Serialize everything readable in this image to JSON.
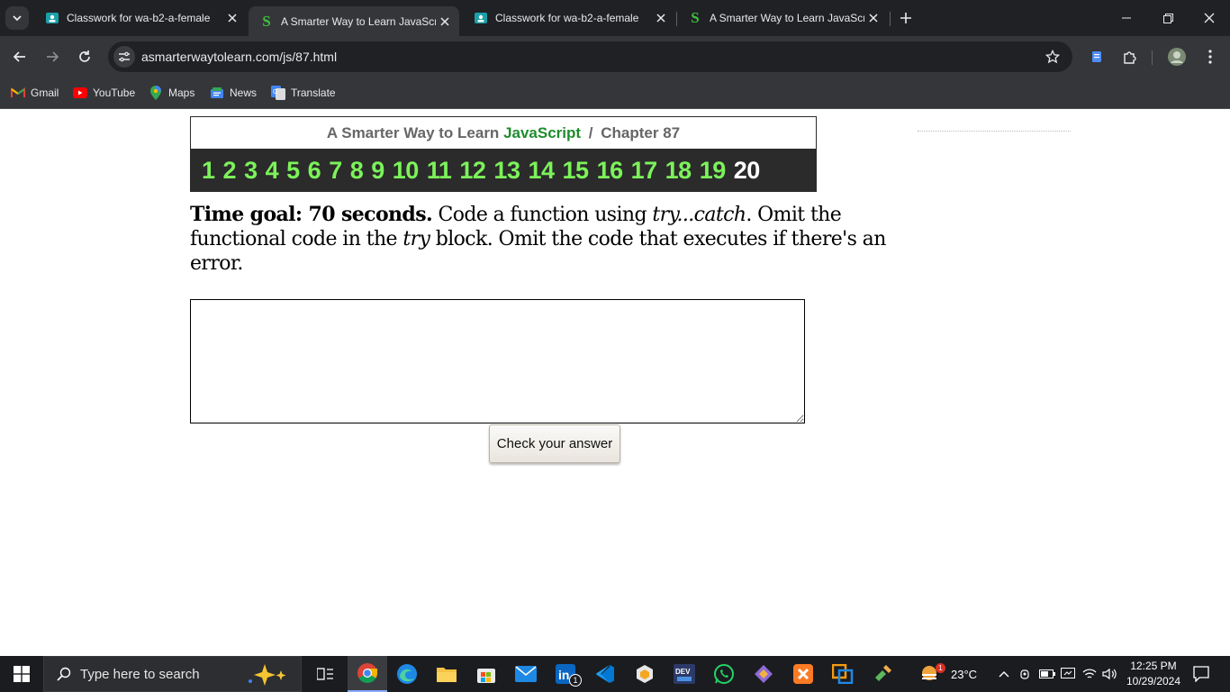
{
  "browser": {
    "tabs": [
      {
        "title": "Classwork for wa-b2-a-female",
        "active": false
      },
      {
        "title": "A Smarter Way to Learn JavaScr",
        "active": true
      },
      {
        "title": "Classwork for wa-b2-a-female",
        "active": false
      },
      {
        "title": "A Smarter Way to Learn JavaScr",
        "active": false
      }
    ],
    "url": "asmarterwaytolearn.com/js/87.html",
    "bookmarks": [
      "Gmail",
      "YouTube",
      "Maps",
      "News",
      "Translate"
    ]
  },
  "page": {
    "header_prefix": "A Smarter Way to Learn",
    "header_js": "JavaScript",
    "header_sep": "/",
    "header_chapter": "Chapter 87",
    "chapters": [
      "1",
      "2",
      "3",
      "4",
      "5",
      "6",
      "7",
      "8",
      "9",
      "10",
      "11",
      "12",
      "13",
      "14",
      "15",
      "16",
      "17",
      "18",
      "19",
      "20"
    ],
    "current_chapter": "20",
    "prompt_bold": "Time goal: 70 seconds.",
    "prompt_1": " Code a function using ",
    "prompt_try_catch": "try...catch",
    "prompt_2": ". Omit the functional code in the ",
    "prompt_try": "try",
    "prompt_3": " block. Omit the code that executes if there's an error.",
    "answer_value": "",
    "check_button": "Check your answer"
  },
  "taskbar": {
    "search_placeholder": "Type here to search",
    "weather": "23°C",
    "time": "12:25 PM",
    "date": "10/29/2024",
    "linkedin_badge": "1",
    "weather_badge": "1"
  },
  "colors": {
    "chapter_link": "#7cf25a",
    "javascript_green": "#1f8c2d",
    "nav_background": "#2b2b2b"
  }
}
